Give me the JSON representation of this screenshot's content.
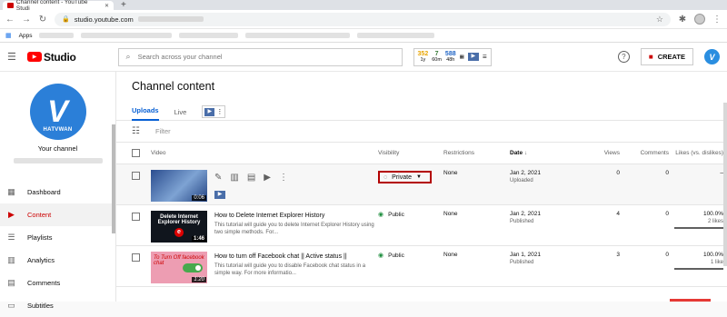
{
  "browser": {
    "tab_title": "Channel content - YouTube Studi",
    "url": "studio.youtube.com",
    "apps_label": "Apps"
  },
  "header": {
    "logo_text": "Studio",
    "search_placeholder": "Search across your channel",
    "stats": [
      {
        "value": "352",
        "label": "1y"
      },
      {
        "value": "7",
        "label": "60m"
      },
      {
        "value": "588",
        "label": "48h"
      }
    ],
    "create_label": "CREATE",
    "help_icon": "?"
  },
  "sidebar": {
    "avatar_text": "HATVWAN",
    "your_channel": "Your channel",
    "items": [
      {
        "label": "Dashboard",
        "icon": "dashboard-icon",
        "active": false
      },
      {
        "label": "Content",
        "icon": "content-icon",
        "active": true
      },
      {
        "label": "Playlists",
        "icon": "playlists-icon",
        "active": false
      },
      {
        "label": "Analytics",
        "icon": "analytics-icon",
        "active": false
      },
      {
        "label": "Comments",
        "icon": "comments-icon",
        "active": false
      },
      {
        "label": "Subtitles",
        "icon": "subtitles-icon",
        "active": false
      }
    ]
  },
  "main": {
    "title": "Channel content",
    "tabs": [
      {
        "label": "Uploads",
        "active": true
      },
      {
        "label": "Live",
        "active": false
      }
    ],
    "filter_placeholder": "Filter",
    "columns": {
      "video": "Video",
      "visibility": "Visibility",
      "restrictions": "Restrictions",
      "date": "Date",
      "views": "Views",
      "comments": "Comments",
      "likes": "Likes (vs. dislikes)"
    },
    "rows": [
      {
        "duration": "0:06",
        "visibility": "Private",
        "restrictions": "None",
        "date": "Jan 2, 2021",
        "date_status": "Uploaded",
        "views": "0",
        "comments": "0",
        "likes": "–"
      },
      {
        "thumb_text": "Delete Internet Explorer History",
        "duration": "1:46",
        "title": "How to Delete Internet Explorer History",
        "description": "This tutorial will guide you to delete Internet Explorer History using two simple methods. For...",
        "visibility": "Public",
        "restrictions": "None",
        "date": "Jan 2, 2021",
        "date_status": "Published",
        "views": "4",
        "comments": "0",
        "likes": "100.0%",
        "likes_count": "2 likes"
      },
      {
        "thumb_text": "To Turn Off facebook chat",
        "duration": "1:20",
        "title": "How to turn off Facebook chat || Active status ||",
        "description": "This tutorial will guide you to disable Facebook chat status in a simple way. For more informatio...",
        "visibility": "Public",
        "restrictions": "None",
        "date": "Jan 1, 2021",
        "date_status": "Published",
        "views": "3",
        "comments": "0",
        "likes": "100.0%",
        "likes_count": "1 like"
      }
    ]
  }
}
